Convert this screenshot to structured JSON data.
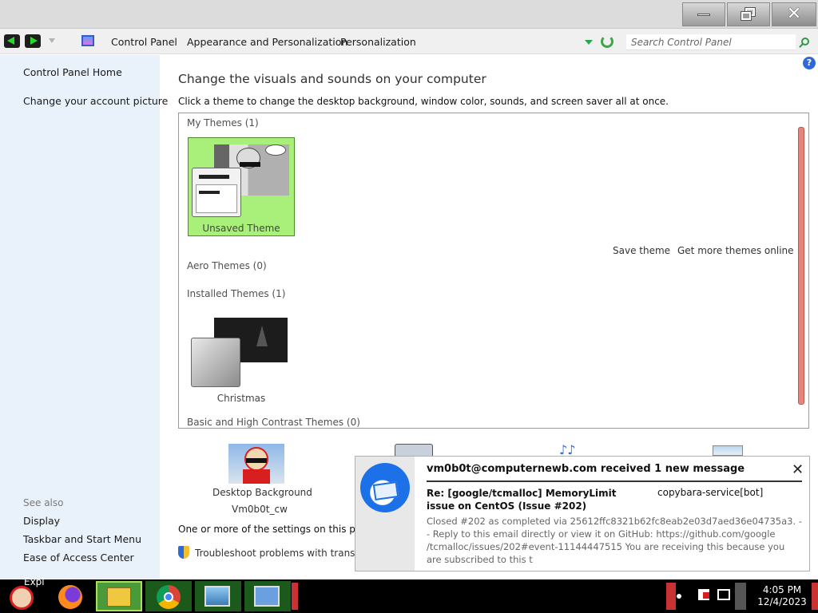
{
  "window": {
    "minimize_label": "",
    "maximize_label": "",
    "close_label": "✕"
  },
  "address": {
    "breadcrumbs": [
      "Control Panel",
      "Appearance and Personalization",
      "Personalization"
    ],
    "search_placeholder": "Search Control Panel"
  },
  "sidebar": {
    "links": [
      "Control Panel Home",
      "Change your account picture"
    ],
    "see_also_label": "See also",
    "see_also": [
      "Display",
      "Taskbar and Start Menu",
      "Ease of Access Center"
    ]
  },
  "main": {
    "help": "?",
    "title": "Change the visuals and sounds on your computer",
    "subtitle": "Click a theme to change the desktop background, window color, sounds, and screen saver all at once.",
    "groups": {
      "my_themes": "My Themes (1)",
      "aero_themes": "Aero Themes (0)",
      "installed_themes": "Installed Themes (1)",
      "basic_themes": "Basic and High Contrast Themes (0)"
    },
    "themes": {
      "unsaved": "Unsaved Theme",
      "christmas": "Christmas"
    },
    "save_theme": "Save theme",
    "get_more": "Get more themes online",
    "desktop_background_label": "Desktop Background",
    "desktop_background_value": "Vm0b0t_cw",
    "note": "One or more of the settings on this page h",
    "troubleshoot": "Troubleshoot problems with transpare"
  },
  "notification": {
    "title": "vm0b0t@computernewb.com received 1 new message",
    "close": "✕",
    "subject": "Re: [google/tcmalloc] MemoryLimit issue on CentOS (Issue #202)",
    "sender": "copybara-service[bot]",
    "body": "Closed #202 as completed via 25612ffc8321b62fc8eab2e03d7aed36e04735a3. -- Reply to this email directly or view it on GitHub: https://github.com/google /tcmalloc/issues/202#event-11144447515 You are receiving this because you are subscribed to this t"
  },
  "taskbar": {
    "start_label": "Expl",
    "clock_time": "4:05 PM",
    "clock_date": "12/4/2023"
  }
}
